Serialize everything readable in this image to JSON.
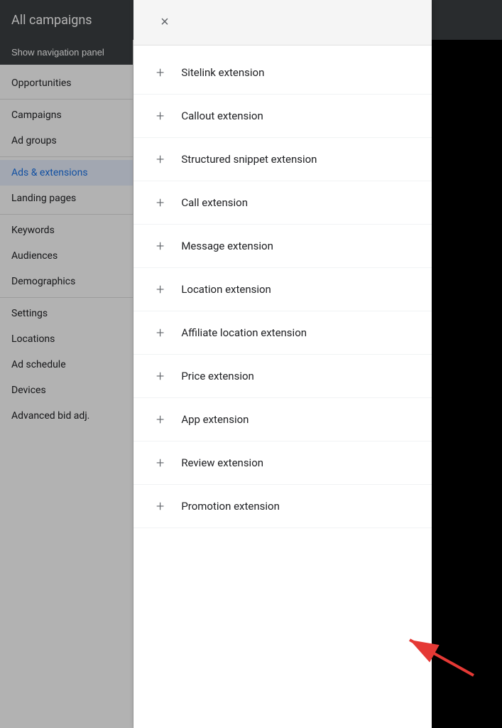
{
  "app": {
    "title": "All campaigns"
  },
  "sidebar": {
    "nav_toggle": "Show navigation panel",
    "items": [
      {
        "id": "opportunities",
        "label": "Opportunities",
        "active": false
      },
      {
        "id": "campaigns",
        "label": "Campaigns",
        "active": false
      },
      {
        "id": "ad-groups",
        "label": "Ad groups",
        "active": false
      },
      {
        "id": "ads-extensions",
        "label": "Ads & extensions",
        "active": true
      },
      {
        "id": "landing-pages",
        "label": "Landing pages",
        "active": false
      },
      {
        "id": "keywords",
        "label": "Keywords",
        "active": false
      },
      {
        "id": "audiences",
        "label": "Audiences",
        "active": false
      },
      {
        "id": "demographics",
        "label": "Demographics",
        "active": false
      },
      {
        "id": "settings",
        "label": "Settings",
        "active": false
      },
      {
        "id": "locations",
        "label": "Locations",
        "active": false
      },
      {
        "id": "ad-schedule",
        "label": "Ad schedule",
        "active": false
      },
      {
        "id": "devices",
        "label": "Devices",
        "active": false
      },
      {
        "id": "advanced-bid",
        "label": "Advanced bid adj.",
        "active": false
      }
    ]
  },
  "extension_panel": {
    "close_label": "×",
    "items": [
      {
        "id": "sitelink",
        "label": "Sitelink extension"
      },
      {
        "id": "callout",
        "label": "Callout extension"
      },
      {
        "id": "structured-snippet",
        "label": "Structured snippet extension"
      },
      {
        "id": "call",
        "label": "Call extension"
      },
      {
        "id": "message",
        "label": "Message extension"
      },
      {
        "id": "location",
        "label": "Location extension"
      },
      {
        "id": "affiliate-location",
        "label": "Affiliate location extension"
      },
      {
        "id": "price",
        "label": "Price extension"
      },
      {
        "id": "app",
        "label": "App extension"
      },
      {
        "id": "review",
        "label": "Review extension"
      },
      {
        "id": "promotion",
        "label": "Promotion extension"
      }
    ]
  },
  "icons": {
    "plus": "+",
    "close": "×"
  }
}
